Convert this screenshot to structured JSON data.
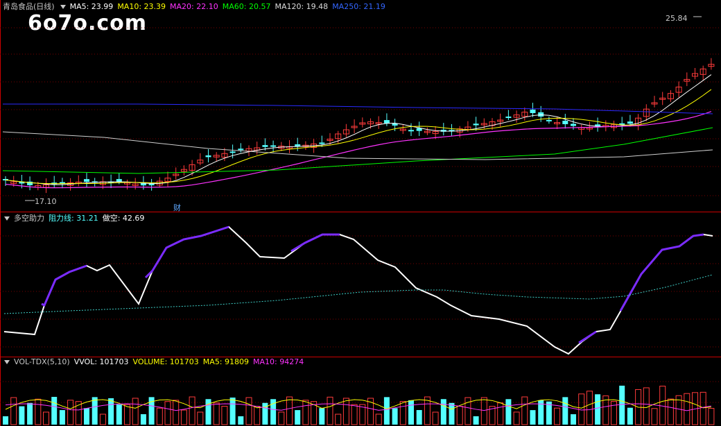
{
  "main": {
    "title": "青岛食品(日线)",
    "ma5": "MA5: 23.99",
    "ma10": "MA10: 23.39",
    "ma20": "MA20: 22.10",
    "ma60": "MA60: 20.57",
    "ma120": "MA120: 19.48",
    "ma250": "MA250: 21.19",
    "high_label": "25.84",
    "low_label": "17.10",
    "fin_marker": "财"
  },
  "watermark": "6o7o.com",
  "indicator": {
    "name": "多空助力",
    "resistance": "阻力线: 31.21",
    "short": "做空: 42.69"
  },
  "volume": {
    "name": "VOL-TDX(5,10)",
    "vvol": "VVOL: 101703",
    "vol": "VOLUME: 101703",
    "ma5": "MA5: 91809",
    "ma10": "MA10: 94274"
  },
  "colors": {
    "up": "#ff3b3b",
    "down": "#54ffff",
    "grid": "#7a0000",
    "ma5": "#ffffff",
    "ma10": "#ffff00",
    "ma20": "#ff33ff",
    "ma60": "#00ff00",
    "ma120": "#d0d0d0",
    "ma250": "#0000ff",
    "line": "#ffffff",
    "purple": "#7b2cff",
    "dash": "#3fd0c8"
  }
}
